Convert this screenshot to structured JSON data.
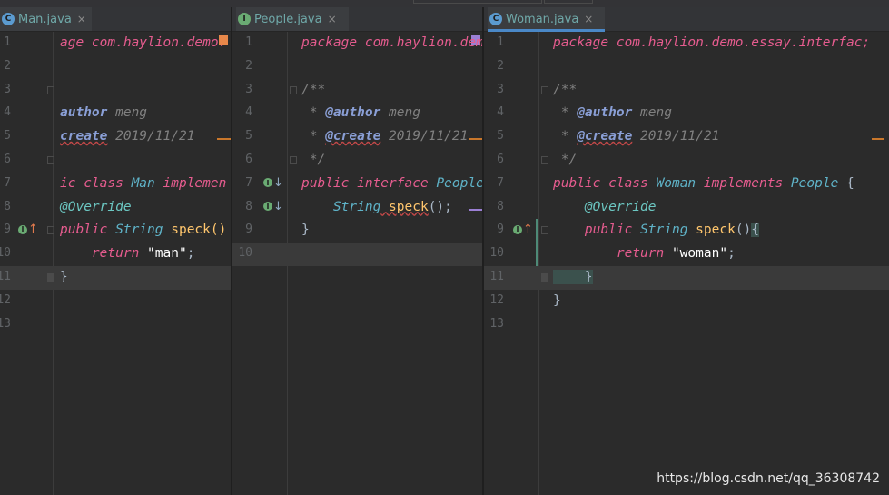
{
  "tabs": [
    {
      "label": "Man.java",
      "icon": "class-file-icon",
      "active": false
    },
    {
      "label": "People.java",
      "icon": "interface-file-icon",
      "active": false
    },
    {
      "label": "Woman.java",
      "icon": "class-file-icon",
      "active": true
    }
  ],
  "tab_icon_letters": {
    "class": "C",
    "iface": "I"
  },
  "close_glyph": "×",
  "man": {
    "lines": [
      "1",
      "2",
      "3",
      "4",
      "5",
      "6",
      "7",
      "8",
      "9",
      "10",
      "11",
      "12",
      "13"
    ],
    "l1": "age com.haylion.demo.",
    "l4_tag": "author",
    "l4_val": " meng",
    "l5_tag": "create",
    "l5_val": " 2019/11/21",
    "l7_a": "ic class ",
    "l7_b": "Man",
    "l7_c": " implemen",
    "l8": "@Override",
    "l9_a": "public",
    "l9_b": " String",
    "l9_c": " speck()",
    "l10_a": "    return ",
    "l10_b": "\"man\"",
    "l10_c": ";",
    "l11": "}"
  },
  "people": {
    "lines": [
      "1",
      "2",
      "3",
      "4",
      "5",
      "6",
      "7",
      "8",
      "9",
      "10"
    ],
    "l1": "package com.haylion.dem",
    "l3": "/**",
    "l4_pre": " * ",
    "l4_tag": "@author",
    "l4_val": " meng",
    "l5_pre": " * ",
    "l5_tag": "@create",
    "l5_val": " 2019/11/21",
    "l6": " */",
    "l7_a": "public",
    "l7_b": " interface",
    "l7_c": " People",
    "l8_a": "    String",
    "l8_b": " speck",
    "l8_c": "();",
    "l9": "}"
  },
  "woman": {
    "lines": [
      "1",
      "2",
      "3",
      "4",
      "5",
      "6",
      "7",
      "8",
      "9",
      "10",
      "11",
      "12",
      "13"
    ],
    "l1": "package com.haylion.demo.essay.interfac;",
    "l3": "/**",
    "l4_pre": " * ",
    "l4_tag": "@author",
    "l4_val": " meng",
    "l5_pre": " * ",
    "l5_tag": "@create",
    "l5_val": " 2019/11/21",
    "l6": " */",
    "l7_a": "public",
    "l7_b": " class",
    "l7_c": " Woman",
    "l7_d": " implements",
    "l7_e": " People",
    "l7_f": " {",
    "l8": "    @Override",
    "l9_a": "    public",
    "l9_b": " String",
    "l9_c": " speck",
    "l9_d": "()",
    "l9_e": "{",
    "l10_a": "        return ",
    "l10_b": "\"woman\"",
    "l10_c": ";",
    "l11": "    }",
    "l12": "}"
  },
  "gutter_icons": {
    "impl_letter": "I",
    "up_arrow": "↑",
    "down_arrow": "↓"
  },
  "watermark": "https://blog.csdn.net/qq_36308742",
  "colors": {
    "accent": "#4a88c7",
    "keyword": "#cc7832",
    "string": "#6a8759",
    "marker": "#c9772b"
  }
}
